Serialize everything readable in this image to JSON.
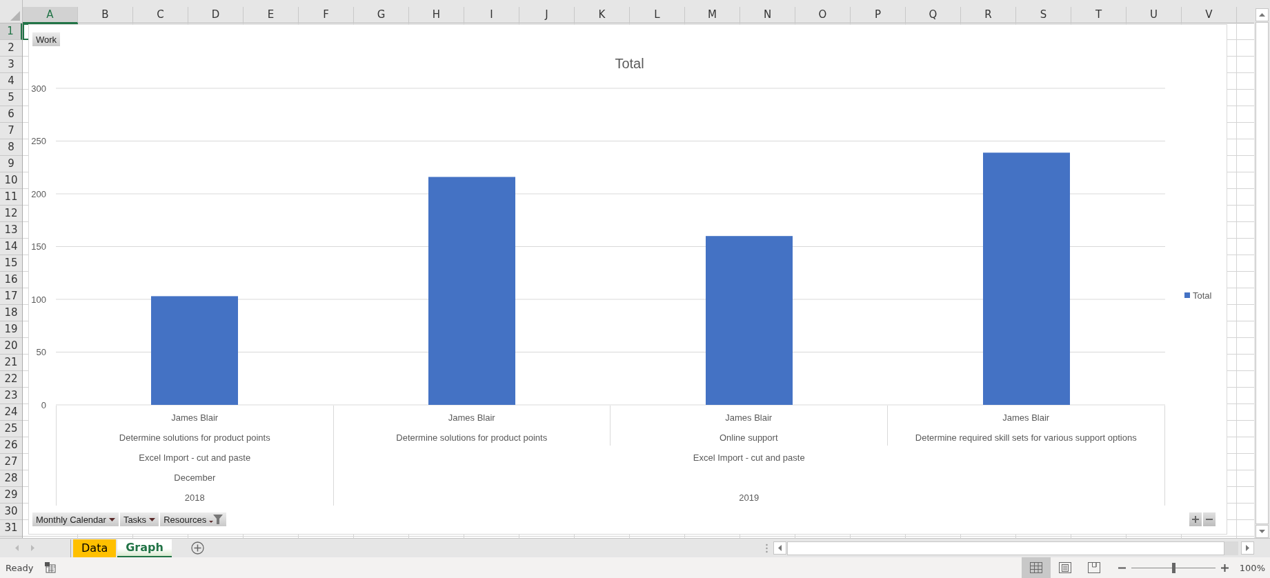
{
  "columns": [
    {
      "label": "A",
      "selected": true
    },
    {
      "label": "B",
      "selected": false
    },
    {
      "label": "C",
      "selected": false
    },
    {
      "label": "D",
      "selected": false
    },
    {
      "label": "E",
      "selected": false
    },
    {
      "label": "F",
      "selected": false
    },
    {
      "label": "G",
      "selected": false
    },
    {
      "label": "H",
      "selected": false
    },
    {
      "label": "I",
      "selected": false
    },
    {
      "label": "J",
      "selected": false
    },
    {
      "label": "K",
      "selected": false
    },
    {
      "label": "L",
      "selected": false
    },
    {
      "label": "M",
      "selected": false
    },
    {
      "label": "N",
      "selected": false
    },
    {
      "label": "O",
      "selected": false
    },
    {
      "label": "P",
      "selected": false
    },
    {
      "label": "Q",
      "selected": false
    },
    {
      "label": "R",
      "selected": false
    },
    {
      "label": "S",
      "selected": false
    },
    {
      "label": "T",
      "selected": false
    },
    {
      "label": "U",
      "selected": false
    },
    {
      "label": "V",
      "selected": false
    }
  ],
  "rows": [
    {
      "label": "1",
      "selected": true
    },
    {
      "label": "2",
      "selected": false
    },
    {
      "label": "3",
      "selected": false
    },
    {
      "label": "4",
      "selected": false
    },
    {
      "label": "5",
      "selected": false
    },
    {
      "label": "6",
      "selected": false
    },
    {
      "label": "7",
      "selected": false
    },
    {
      "label": "8",
      "selected": false
    },
    {
      "label": "9",
      "selected": false
    },
    {
      "label": "10",
      "selected": false
    },
    {
      "label": "11",
      "selected": false
    },
    {
      "label": "12",
      "selected": false
    },
    {
      "label": "13",
      "selected": false
    },
    {
      "label": "14",
      "selected": false
    },
    {
      "label": "15",
      "selected": false
    },
    {
      "label": "16",
      "selected": false
    },
    {
      "label": "17",
      "selected": false
    },
    {
      "label": "18",
      "selected": false
    },
    {
      "label": "19",
      "selected": false
    },
    {
      "label": "20",
      "selected": false
    },
    {
      "label": "21",
      "selected": false
    },
    {
      "label": "22",
      "selected": false
    },
    {
      "label": "23",
      "selected": false
    },
    {
      "label": "24",
      "selected": false
    },
    {
      "label": "25",
      "selected": false
    },
    {
      "label": "26",
      "selected": false
    },
    {
      "label": "27",
      "selected": false
    },
    {
      "label": "28",
      "selected": false
    },
    {
      "label": "29",
      "selected": false
    },
    {
      "label": "30",
      "selected": false
    },
    {
      "label": "31",
      "selected": false
    }
  ],
  "pivot_chart": {
    "filter_buttons": [
      {
        "label": "Work",
        "kind": "plain"
      }
    ],
    "chart_data": {
      "type": "bar",
      "title": "Total",
      "categories": [
        "James Blair",
        "James Blair",
        "James Blair",
        "James Blair"
      ],
      "series": [
        {
          "name": "Total",
          "color": "#4472c4",
          "values": [
            103,
            216,
            160,
            239
          ]
        }
      ],
      "grid": true,
      "ylim": [
        0,
        300
      ],
      "yticks": [
        0,
        50,
        100,
        150,
        200,
        250,
        300
      ]
    },
    "category_groups": [
      {
        "label": "2018",
        "children": [
          {
            "label": "December",
            "children": [
              {
                "label": "Excel Import - cut and paste",
                "children": [
                  {
                    "label": "Determine solutions for product points"
                  }
                ]
              }
            ]
          }
        ]
      },
      {
        "label": "2019",
        "children": [
          {
            "label": "Excel Import - cut and paste",
            "children": [
              {
                "label": "Determine solutions for product points"
              },
              {
                "label": "Online support"
              },
              {
                "label": "Determine required skill sets for various support options"
              }
            ]
          }
        ]
      }
    ],
    "axis_buttons": [
      {
        "label": "Monthly Calendar",
        "kind": "dropdown"
      },
      {
        "label": "Tasks",
        "kind": "dropdown"
      },
      {
        "label": "Resources",
        "kind": "filtered"
      }
    ],
    "expand_buttons": [
      {
        "kind": "expand"
      },
      {
        "kind": "collapse"
      }
    ]
  },
  "sheet_tabs": [
    {
      "label": "Data",
      "selected": false,
      "color": "#ffc000"
    },
    {
      "label": "Graph",
      "selected": true
    }
  ],
  "status_bar": {
    "status": "Ready",
    "views": [
      {
        "kind": "normal",
        "selected": true
      },
      {
        "kind": "page-layout",
        "selected": false
      },
      {
        "kind": "page-break",
        "selected": false
      }
    ],
    "zoom": {
      "level": 0.5,
      "reading": "100%"
    }
  }
}
